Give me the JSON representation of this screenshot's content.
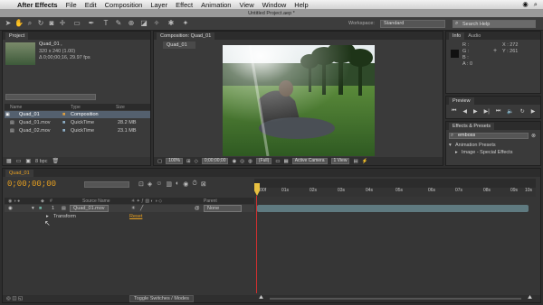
{
  "menubar": {
    "app": "After Effects",
    "items": [
      "File",
      "Edit",
      "Composition",
      "Layer",
      "Effect",
      "Animation",
      "View",
      "Window",
      "Help"
    ]
  },
  "window_title": "Untitled Project.aep *",
  "toolbar": {
    "workspace_label": "Workspace:",
    "workspace_value": "Standard",
    "search_placeholder": "Search Help"
  },
  "project_panel": {
    "tab": "Project",
    "comp_name": "Quad_01 ,",
    "comp_size": "320 x 240 (1.00)",
    "comp_duration": "Δ 0;00;00;16, 29.97 fps",
    "headers": {
      "name": "Name",
      "type": "Type",
      "size": "Size"
    },
    "items": [
      {
        "name": "Quad_01",
        "type": "Composition",
        "size": ""
      },
      {
        "name": "Quad_01.mov",
        "type": "QuickTime",
        "size": "28.2 MB"
      },
      {
        "name": "Quad_02.mov",
        "type": "QuickTime",
        "size": "23.1 MB"
      }
    ],
    "bpc": "8 bpc"
  },
  "comp_panel": {
    "tab": "Composition: Quad_01",
    "subtab": "Quad_01",
    "zoom": "100%",
    "timecode": "0;00;00;00",
    "resolution": "(Full)",
    "camera": "Active Camera",
    "views": "1 View"
  },
  "info_panel": {
    "tabs": [
      "Info",
      "Audio"
    ],
    "r": "R :",
    "g": "G :",
    "b": "B :",
    "a": "A : 0",
    "x": "X : 272",
    "y": "Y : 261"
  },
  "preview_panel": {
    "tab": "Preview"
  },
  "effects_panel": {
    "tab": "Effects & Presets",
    "search": "emboss",
    "tree": [
      "Animation Presets",
      "Image - Special Effects"
    ]
  },
  "timeline": {
    "tab": "Quad_01",
    "timecode": "0;00;00;00",
    "layer_header": "Source Name",
    "parent_header": "Parent",
    "layer_num": "1",
    "layer_name": "Quad_01.mov",
    "parent_value": "None",
    "transform_label": "Transform",
    "reset_label": "Reset",
    "ticks": [
      "0:00f",
      "01s",
      "02s",
      "03s",
      "04s",
      "05s",
      "06s",
      "07s",
      "08s",
      "09s",
      "10s"
    ],
    "footer": "Toggle Switches / Modes"
  },
  "colors": {
    "accent_orange": "#e8a020",
    "layer_bar": "#5f7a80",
    "selection": "#54606e"
  }
}
